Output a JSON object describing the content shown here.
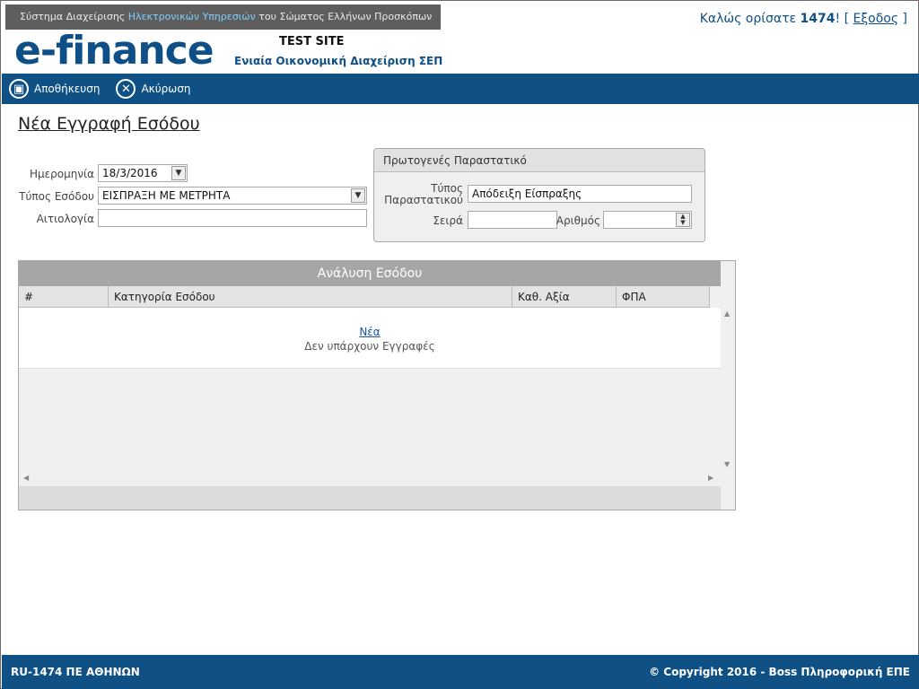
{
  "header": {
    "system_pre": "Σύστημα Διαχείρισης ",
    "system_hl": "Ηλεκτρονικών Υπηρεσιών",
    "system_post": " του Σώματος Ελλήνων Προσκόπων",
    "logo": "e-finance",
    "test_site": "TEST SITE",
    "subtitle": "Ενιαία Οικονομική Διαχείριση ΣΕΠ",
    "welcome_pre": "Καλώς ορίσατε ",
    "user": "1474",
    "welcome_mid": "! [ ",
    "logout": "Εξοδος",
    "welcome_post": " ]"
  },
  "toolbar": {
    "save_label": "Αποθήκευση",
    "cancel_label": "Ακύρωση"
  },
  "form": {
    "title": "Νέα Εγγραφή Εσόδου",
    "date_label": "Ημερομηνία",
    "date_value": "18/3/2016",
    "type_label": "Τύπος Εσόδου",
    "type_value": "ΕΙΣΠΡΑΞΗ ΜΕ ΜΕΤΡΗΤΑ",
    "reason_label": "Αιτιολογία",
    "reason_value": ""
  },
  "document_panel": {
    "title": "Πρωτογενές Παραστατικό",
    "doc_type_label_1": "Τύπος",
    "doc_type_label_2": "Παραστατικού",
    "doc_type_value": "Απόδειξη Είσπραξης",
    "series_label": "Σειρά",
    "series_value": "",
    "number_label": "Αριθμός",
    "number_value": ""
  },
  "grid": {
    "title": "Ανάλυση Εσόδου",
    "columns": [
      "#",
      "Κατηγορία Εσόδου",
      "Καθ. Αξία",
      "ΦΠΑ"
    ],
    "new_link": "Νέα",
    "empty_text": "Δεν υπάρχουν Εγγραφές"
  },
  "footer": {
    "left": "RU-1474 ΠΕ ΑΘΗΝΩΝ",
    "right": "© Copyright 2016 - Boss Πληροφορική ΕΠΕ"
  },
  "colors": {
    "brand": "#0f5085",
    "topbar": "#5e5e5e"
  }
}
